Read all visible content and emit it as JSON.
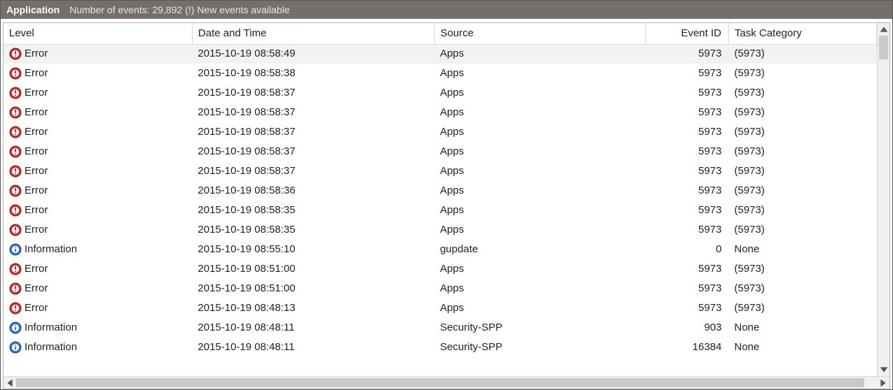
{
  "header": {
    "app_name": "Application",
    "status_text": "Number of events: 29,892 (!) New events available"
  },
  "columns": {
    "level": "Level",
    "datetime": "Date and Time",
    "source": "Source",
    "event_id": "Event ID",
    "task_category": "Task Category"
  },
  "rows": [
    {
      "level_icon": "error",
      "level": "Error",
      "datetime": "2015-10-19 08:58:49",
      "source": "Apps",
      "event_id": "5973",
      "task_category": "(5973)",
      "selected": true
    },
    {
      "level_icon": "error",
      "level": "Error",
      "datetime": "2015-10-19 08:58:38",
      "source": "Apps",
      "event_id": "5973",
      "task_category": "(5973)"
    },
    {
      "level_icon": "error",
      "level": "Error",
      "datetime": "2015-10-19 08:58:37",
      "source": "Apps",
      "event_id": "5973",
      "task_category": "(5973)"
    },
    {
      "level_icon": "error",
      "level": "Error",
      "datetime": "2015-10-19 08:58:37",
      "source": "Apps",
      "event_id": "5973",
      "task_category": "(5973)"
    },
    {
      "level_icon": "error",
      "level": "Error",
      "datetime": "2015-10-19 08:58:37",
      "source": "Apps",
      "event_id": "5973",
      "task_category": "(5973)"
    },
    {
      "level_icon": "error",
      "level": "Error",
      "datetime": "2015-10-19 08:58:37",
      "source": "Apps",
      "event_id": "5973",
      "task_category": "(5973)"
    },
    {
      "level_icon": "error",
      "level": "Error",
      "datetime": "2015-10-19 08:58:37",
      "source": "Apps",
      "event_id": "5973",
      "task_category": "(5973)"
    },
    {
      "level_icon": "error",
      "level": "Error",
      "datetime": "2015-10-19 08:58:36",
      "source": "Apps",
      "event_id": "5973",
      "task_category": "(5973)"
    },
    {
      "level_icon": "error",
      "level": "Error",
      "datetime": "2015-10-19 08:58:35",
      "source": "Apps",
      "event_id": "5973",
      "task_category": "(5973)"
    },
    {
      "level_icon": "error",
      "level": "Error",
      "datetime": "2015-10-19 08:58:35",
      "source": "Apps",
      "event_id": "5973",
      "task_category": "(5973)"
    },
    {
      "level_icon": "info",
      "level": "Information",
      "datetime": "2015-10-19 08:55:10",
      "source": "gupdate",
      "event_id": "0",
      "task_category": "None"
    },
    {
      "level_icon": "error",
      "level": "Error",
      "datetime": "2015-10-19 08:51:00",
      "source": "Apps",
      "event_id": "5973",
      "task_category": "(5973)"
    },
    {
      "level_icon": "error",
      "level": "Error",
      "datetime": "2015-10-19 08:51:00",
      "source": "Apps",
      "event_id": "5973",
      "task_category": "(5973)"
    },
    {
      "level_icon": "error",
      "level": "Error",
      "datetime": "2015-10-19 08:48:13",
      "source": "Apps",
      "event_id": "5973",
      "task_category": "(5973)"
    },
    {
      "level_icon": "info",
      "level": "Information",
      "datetime": "2015-10-19 08:48:11",
      "source": "Security-SPP",
      "event_id": "903",
      "task_category": "None"
    },
    {
      "level_icon": "info",
      "level": "Information",
      "datetime": "2015-10-19 08:48:11",
      "source": "Security-SPP",
      "event_id": "16384",
      "task_category": "None"
    }
  ]
}
